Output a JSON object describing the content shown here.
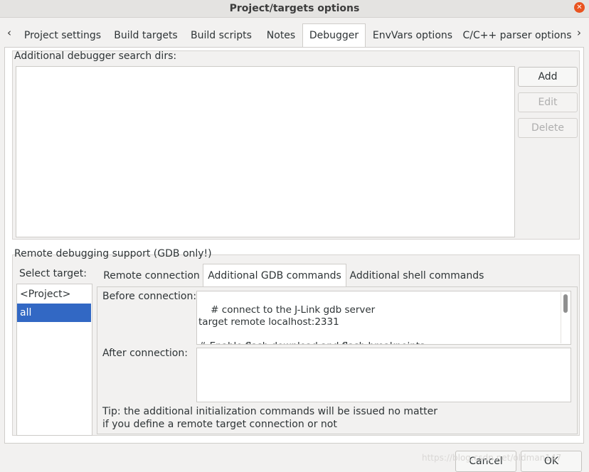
{
  "window": {
    "title": "Project/targets options"
  },
  "tabs": [
    "Project settings",
    "Build targets",
    "Build scripts",
    "Notes",
    "Debugger",
    "EnvVars options",
    "C/C++ parser options"
  ],
  "active_tab": "Debugger",
  "debugger_dirs": {
    "label": "Additional debugger search dirs:",
    "buttons": {
      "add": "Add",
      "edit": "Edit",
      "delete": "Delete"
    }
  },
  "remote": {
    "label": "Remote debugging support (GDB only!)",
    "select_target_label": "Select target:",
    "targets": [
      "<Project>",
      "all"
    ],
    "selected_target": "all",
    "subtabs": [
      "Remote connection",
      "Additional GDB commands",
      "Additional shell commands"
    ],
    "active_subtab": "Additional GDB commands",
    "before_label": "Before connection:",
    "before_text": "# connect to the J-Link gdb server\ntarget remote localhost:2331\n\n# Enable flash download and flash breakpoints.\n# Flash download and flash breakpoints are features of",
    "after_label": "After connection:",
    "after_text": "",
    "tip_line1": "Tip: the additional initialization commands will be issued no matter",
    "tip_line2": "if you define a remote target connection or not"
  },
  "footer": {
    "cancel": "Cancel",
    "ok": "OK"
  },
  "watermark": "https://blog.csdn.net/oldman147"
}
